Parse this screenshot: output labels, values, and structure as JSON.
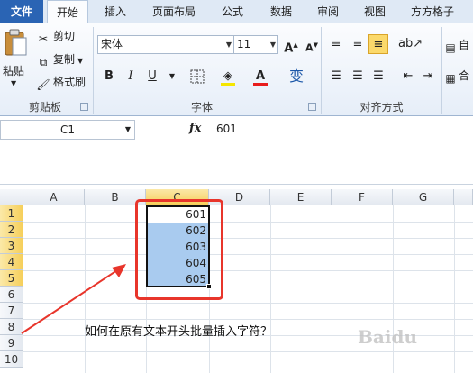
{
  "ribbon_tabs": [
    "文件",
    "开始",
    "插入",
    "页面布局",
    "公式",
    "数据",
    "审阅",
    "视图",
    "方方格子"
  ],
  "clipboard": {
    "paste_label": "粘贴",
    "cut_label": "剪切",
    "copy_label": "复制",
    "format_painter_label": "格式刷",
    "group_label": "剪贴板"
  },
  "font": {
    "name": "宋体",
    "size": "11",
    "grow": "A",
    "shrink": "A",
    "bold": "B",
    "italic": "I",
    "underline": "U",
    "font_color_glyph": "A",
    "phonetic": "变",
    "group_label": "字体",
    "font_color": "#e81c1c",
    "highlight_color": "#f5e600"
  },
  "alignment": {
    "group_label": "对齐方式",
    "wrap_partial": "自",
    "merge_partial": "合"
  },
  "formula_bar": {
    "name_box": "C1",
    "fx": "fx",
    "value": "601"
  },
  "sheet": {
    "columns": [
      "A",
      "B",
      "C",
      "D",
      "E",
      "F",
      "G"
    ],
    "rows": [
      "1",
      "2",
      "3",
      "4",
      "5",
      "6",
      "7",
      "8",
      "9",
      "10"
    ],
    "selected_column": "C",
    "selected_rows": [
      "1",
      "2",
      "3",
      "4",
      "5"
    ],
    "c_values": [
      "601",
      "602",
      "603",
      "604",
      "605"
    ],
    "caption": "如何在原有文本开头批量插入字符？",
    "accent_red": "#e8352b",
    "selection_fill": "#a9cbef"
  },
  "watermark": "Baidu"
}
